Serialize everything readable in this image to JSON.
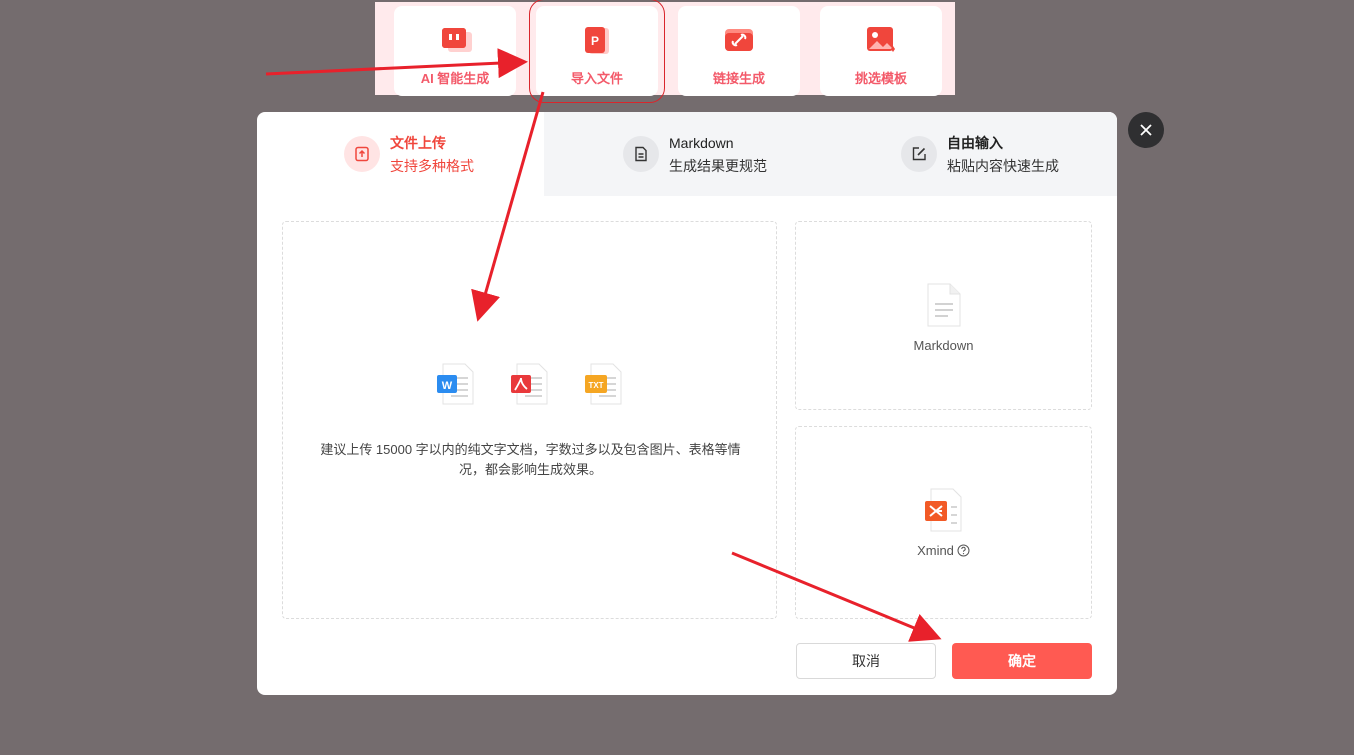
{
  "mode_cards": [
    {
      "label": "AI 智能生成",
      "icon": "chat-bubble-icon"
    },
    {
      "label": "导入文件",
      "icon": "ppt-file-icon",
      "selected": true
    },
    {
      "label": "链接生成",
      "icon": "link-icon"
    },
    {
      "label": "挑选模板",
      "icon": "image-template-icon"
    }
  ],
  "modal": {
    "tabs": [
      {
        "title": "文件上传",
        "subtitle": "支持多种格式",
        "icon": "upload-icon",
        "active": true
      },
      {
        "title": "Markdown",
        "subtitle": "生成结果更规范",
        "icon": "document-icon",
        "active": false
      },
      {
        "title": "自由输入",
        "subtitle": "粘贴内容快速生成",
        "icon": "edit-icon",
        "active": false
      }
    ],
    "upload": {
      "file_types": [
        "W",
        "PDF",
        "TXT"
      ],
      "hint": "建议上传 15000 字以内的纯文字文档，字数过多以及包含图片、表格等情况，都会影响生成效果。"
    },
    "side_options": [
      {
        "label": "Markdown",
        "icon": "markdown-file-icon"
      },
      {
        "label": "Xmind",
        "icon": "xmind-file-icon",
        "help_icon": "question-circle-icon"
      }
    ],
    "buttons": {
      "cancel": "取消",
      "confirm": "确定"
    }
  },
  "colors": {
    "accent": "#f0463c",
    "confirm_button": "#ff5a52",
    "annotation_arrow": "#e8212b",
    "overlay": "#746c6e"
  }
}
